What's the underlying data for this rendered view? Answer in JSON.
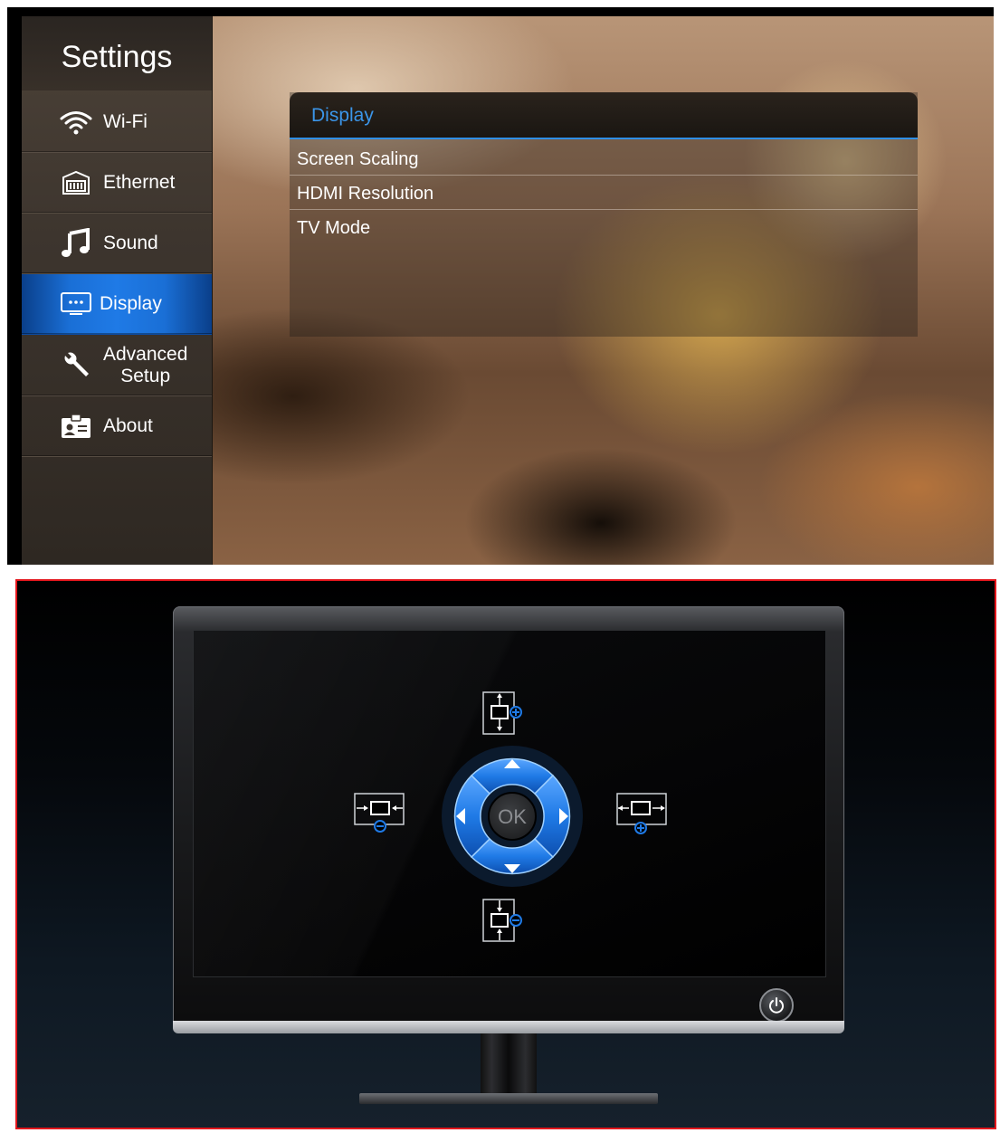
{
  "settings": {
    "title": "Settings",
    "items": [
      {
        "label": "Wi-Fi",
        "icon": "wifi-icon"
      },
      {
        "label": "Ethernet",
        "icon": "ethernet-icon"
      },
      {
        "label": "Sound",
        "icon": "music-note-icon"
      },
      {
        "label": "Display",
        "icon": "display-icon",
        "active": true
      },
      {
        "label_line1": "Advanced",
        "label_line2": "Setup",
        "icon": "wrench-icon"
      },
      {
        "label": "About",
        "icon": "id-card-icon"
      }
    ]
  },
  "display_panel": {
    "title": "Display",
    "items": [
      "Screen Scaling",
      "HDMI  Resolution",
      "TV Mode"
    ]
  },
  "scaling_screen": {
    "ok_label": "OK",
    "accent_color": "#1f7ae6",
    "frame_color": "#e3161c"
  }
}
